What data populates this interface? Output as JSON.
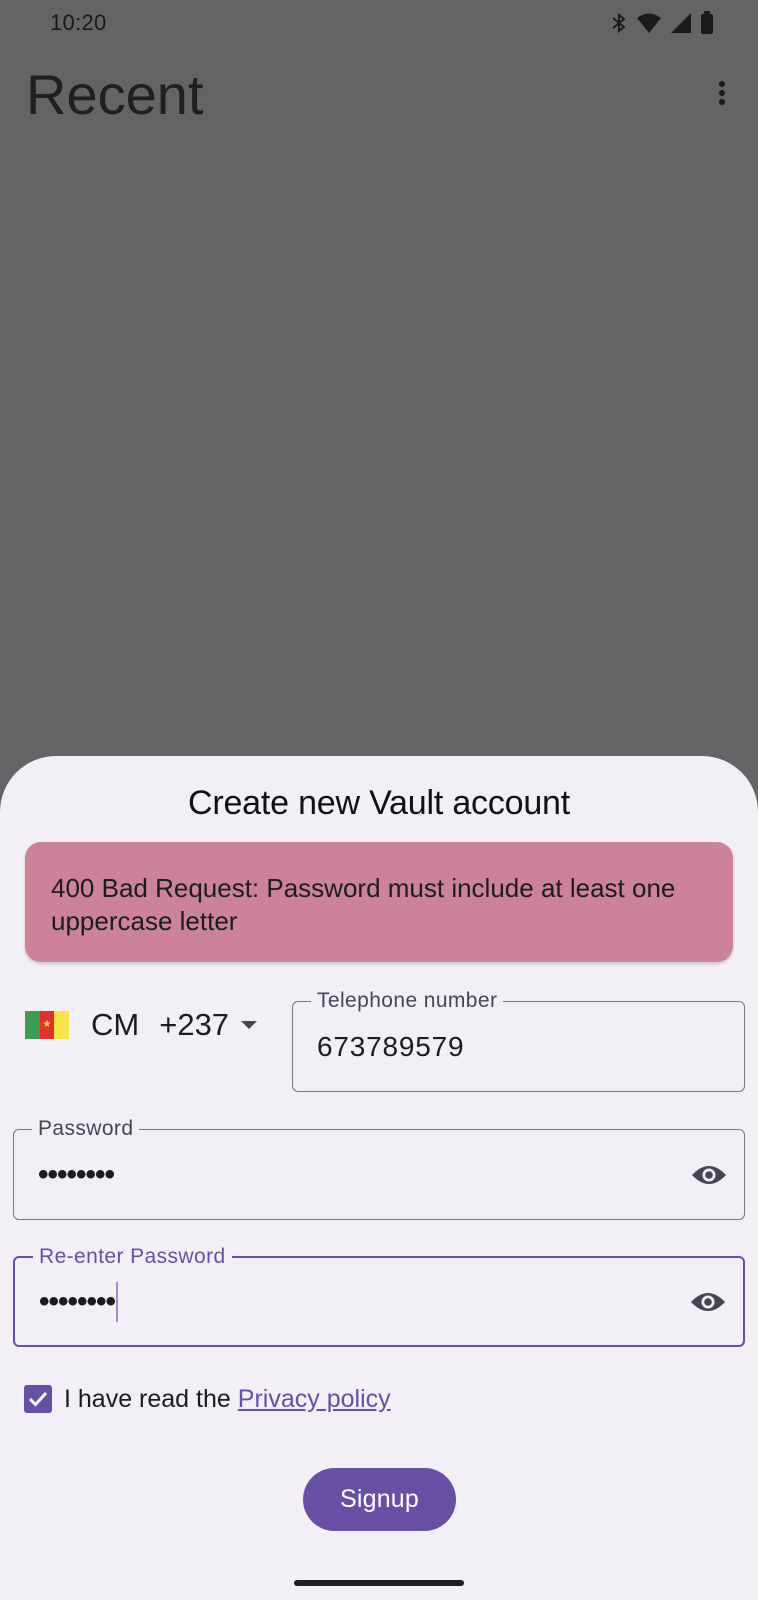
{
  "status_bar": {
    "time": "10:20",
    "icons": [
      "bluetooth-icon",
      "wifi-icon",
      "cellular-signal-icon",
      "battery-icon"
    ]
  },
  "app_bar": {
    "title": "Recent",
    "menu_icon": "more-vert-icon"
  },
  "sheet": {
    "title": "Create new Vault account",
    "error_message": "400 Bad Request: Password must include at least one uppercase letter",
    "error_color": "#cc8299",
    "country": {
      "flag_icon": "cameroon-flag-icon",
      "code": "CM",
      "dial_code": "+237"
    },
    "phone_field": {
      "label": "Telephone number",
      "value": "673789579"
    },
    "password_field": {
      "label": "Password",
      "value": "••••••••",
      "toggle_icon": "visibility-eye-icon"
    },
    "reenter_password_field": {
      "label": "Re-enter Password",
      "value": "••••••••",
      "toggle_icon": "visibility-eye-icon",
      "focused": true
    },
    "consent": {
      "checked": true,
      "text": "I have read the",
      "link": "Privacy policy"
    },
    "signup_label": "Signup",
    "accent_color": "#6750a4"
  }
}
